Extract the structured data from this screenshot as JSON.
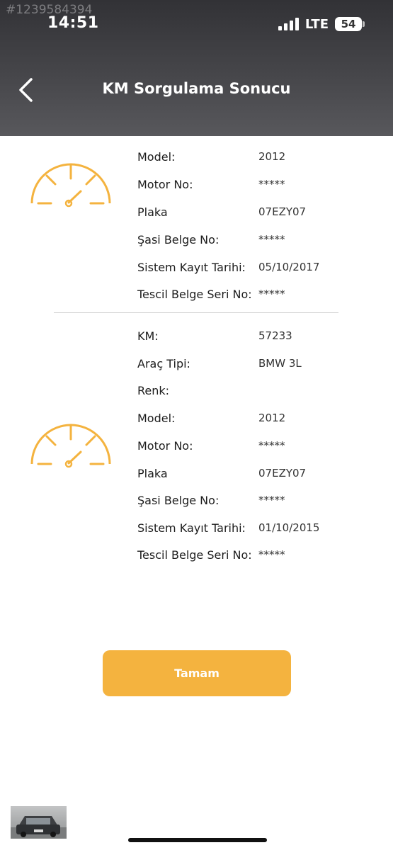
{
  "watermark": "#1239584394",
  "status_bar": {
    "time": "14:51",
    "network": "LTE",
    "battery": "54"
  },
  "header": {
    "title": "KM Sorgulama Sonucu"
  },
  "colors": {
    "accent": "#f4b33f",
    "header_bg": "#46464a"
  },
  "icons": {
    "back": "chevron-left-icon",
    "gauge": "speedometer-icon"
  },
  "record1": {
    "rows": [
      {
        "label": "Model:",
        "value": "2012"
      },
      {
        "label": "Motor No:",
        "value": "*****"
      },
      {
        "label": "Plaka",
        "value": "07EZY07"
      },
      {
        "label": "Şasi Belge No:",
        "value": "*****"
      },
      {
        "label": "Sistem Kayıt Tarihi:",
        "value": "05/10/2017"
      },
      {
        "label": "Tescil Belge Seri No:",
        "value": "*****"
      }
    ]
  },
  "record2": {
    "rows": [
      {
        "label": "KM:",
        "value": "57233"
      },
      {
        "label": "Araç Tipi:",
        "value": "BMW 3L"
      },
      {
        "label": "Renk:",
        "value": ""
      },
      {
        "label": "Model:",
        "value": "2012"
      },
      {
        "label": "Motor No:",
        "value": "*****"
      },
      {
        "label": "Plaka",
        "value": "07EZY07"
      },
      {
        "label": "Şasi Belge No:",
        "value": "*****"
      },
      {
        "label": "Sistem Kayıt Tarihi:",
        "value": "01/10/2015"
      },
      {
        "label": "Tescil Belge Seri No:",
        "value": "*****"
      }
    ]
  },
  "ok_button": {
    "label": "Tamam"
  }
}
